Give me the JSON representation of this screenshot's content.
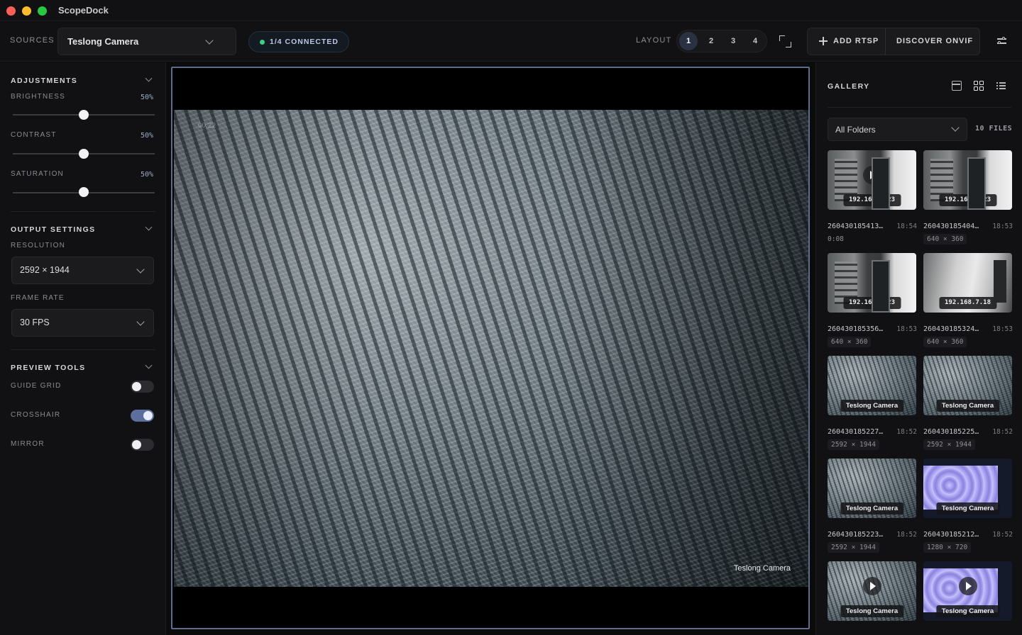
{
  "app": {
    "title": "ScopeDock"
  },
  "toolbar": {
    "sources_label": "SOURCES",
    "source_value": "Teslong Camera",
    "status": "1/4 CONNECTED",
    "layout_label": "LAYOUT",
    "layout_options": [
      "1",
      "2",
      "3",
      "4"
    ],
    "layout_selected": "1",
    "add_rtsp": "ADD RTSP",
    "discover_onvif": "DISCOVER ONVIF"
  },
  "adjustments": {
    "title": "ADJUSTMENTS",
    "brightness_label": "BRIGHTNESS",
    "brightness_value": "50%",
    "contrast_label": "CONTRAST",
    "contrast_value": "50%",
    "saturation_label": "SATURATION",
    "saturation_value": "50%"
  },
  "output": {
    "title": "OUTPUT SETTINGS",
    "resolution_label": "RESOLUTION",
    "resolution_value": "2592 × 1944",
    "framerate_label": "FRAME RATE",
    "framerate_value": "30 FPS"
  },
  "preview": {
    "title": "PREVIEW TOOLS",
    "guide_grid_label": "GUIDE GRID",
    "guide_grid_on": false,
    "crosshair_label": "CROSSHAIR",
    "crosshair_on": true,
    "mirror_label": "MIRROR",
    "mirror_on": false
  },
  "viewer": {
    "camera_label": "Teslong Camera",
    "overlay_text": "00:22"
  },
  "gallery": {
    "title": "GALLERY",
    "folder_value": "All Folders",
    "file_count": "10 FILES",
    "items": [
      {
        "tag": "192.168.7.23",
        "name": "260430185413…",
        "time": "18:54",
        "meta": "0:08",
        "kind": "room",
        "video": true
      },
      {
        "tag": "192.168.7.23",
        "name": "260430185404…",
        "time": "18:53",
        "meta": "640 × 360",
        "kind": "room",
        "video": false
      },
      {
        "tag": "192.168.7.23",
        "name": "260430185356…",
        "time": "18:53",
        "meta": "640 × 360",
        "kind": "room",
        "video": false
      },
      {
        "tag": "192.168.7.18",
        "name": "260430185324…",
        "time": "18:53",
        "meta": "640 × 360",
        "kind": "hall",
        "video": false
      },
      {
        "tag": "Teslong Camera",
        "name": "260430185227…",
        "time": "18:52",
        "meta": "2592 × 1944",
        "kind": "mesh",
        "video": false
      },
      {
        "tag": "Teslong Camera",
        "name": "260430185225…",
        "time": "18:52",
        "meta": "2592 × 1944",
        "kind": "mesh",
        "video": false
      },
      {
        "tag": "Teslong Camera",
        "name": "260430185223…",
        "time": "18:52",
        "meta": "2592 × 1944",
        "kind": "mesh",
        "video": false
      },
      {
        "tag": "Teslong Camera",
        "name": "260430185212…",
        "time": "18:52",
        "meta": "1280 × 720",
        "kind": "lens",
        "video": false
      },
      {
        "tag": "Teslong Camera",
        "name": "",
        "time": "",
        "meta": "",
        "kind": "mesh",
        "video": true
      },
      {
        "tag": "Teslong Camera",
        "name": "",
        "time": "",
        "meta": "",
        "kind": "lens",
        "video": true
      }
    ]
  }
}
